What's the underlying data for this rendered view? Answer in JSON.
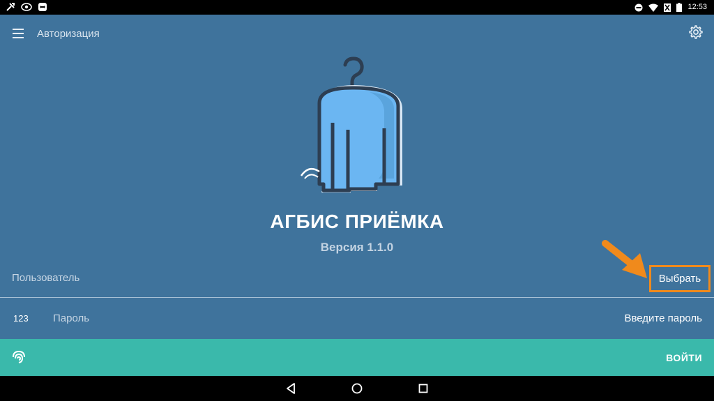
{
  "status_bar": {
    "time": "12:53",
    "left_icons": [
      "tools-icon",
      "eye-icon",
      "teamviewer-icon"
    ],
    "right_icons": [
      "do-not-disturb-icon",
      "wifi-icon",
      "no-sim-icon",
      "battery-icon"
    ]
  },
  "toolbar": {
    "title": "Авторизация"
  },
  "app": {
    "name": "АГБИС ПРИЁМКА",
    "version": "Версия 1.1.0"
  },
  "user": {
    "label": "Пользователь",
    "select_button": "Выбрать"
  },
  "password": {
    "prefix": "123",
    "label": "Пароль",
    "placeholder": "Введите пароль",
    "value": ""
  },
  "login": {
    "button_label": "ВОЙТИ"
  },
  "colors": {
    "background": "#3f739c",
    "login_bar": "#3ab9ab",
    "highlight": "#f08a1c"
  }
}
